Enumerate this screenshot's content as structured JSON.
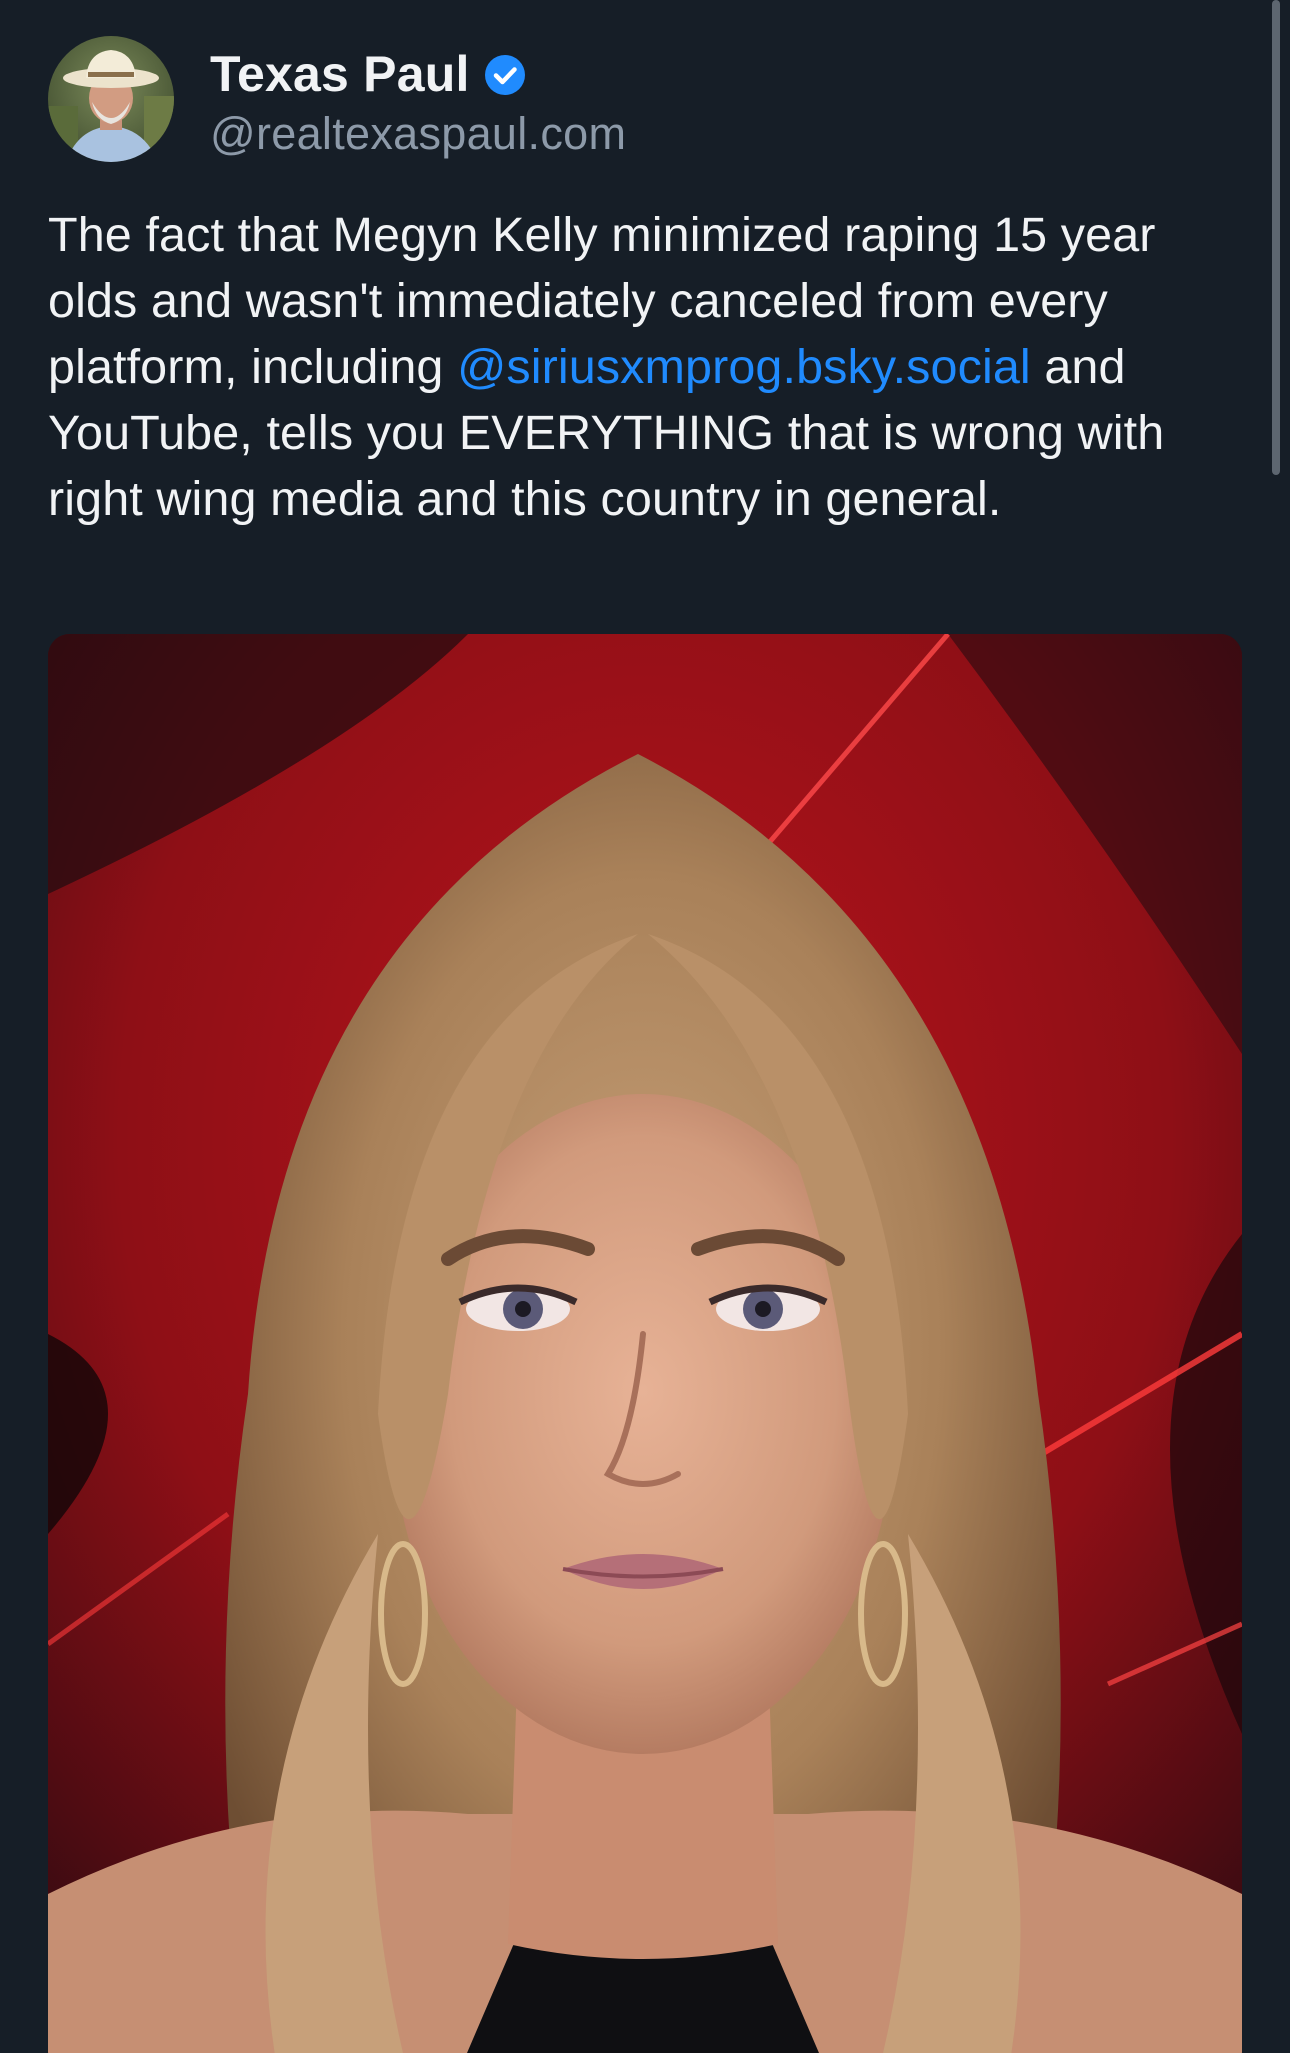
{
  "post": {
    "author": {
      "display_name": "Texas Paul",
      "handle": "@realtexaspaul.com",
      "verified": true,
      "verified_icon": "verified-check-icon"
    },
    "text": {
      "part1": "The fact that Megyn Kelly minimized raping 15 year olds and wasn't immediately canceled from every platform, including ",
      "mention": "@siriusxmprog.bsky.social",
      "part2": " and YouTube, tells you EVERYTHING that is wrong with right wing media and this country in general."
    },
    "media": {
      "kind": "photo"
    }
  },
  "colors": {
    "background": "#161e27",
    "text": "#f1f3f5",
    "handle": "#8d9aa9",
    "link": "#208bfe",
    "verified_badge": "#208bfe"
  }
}
